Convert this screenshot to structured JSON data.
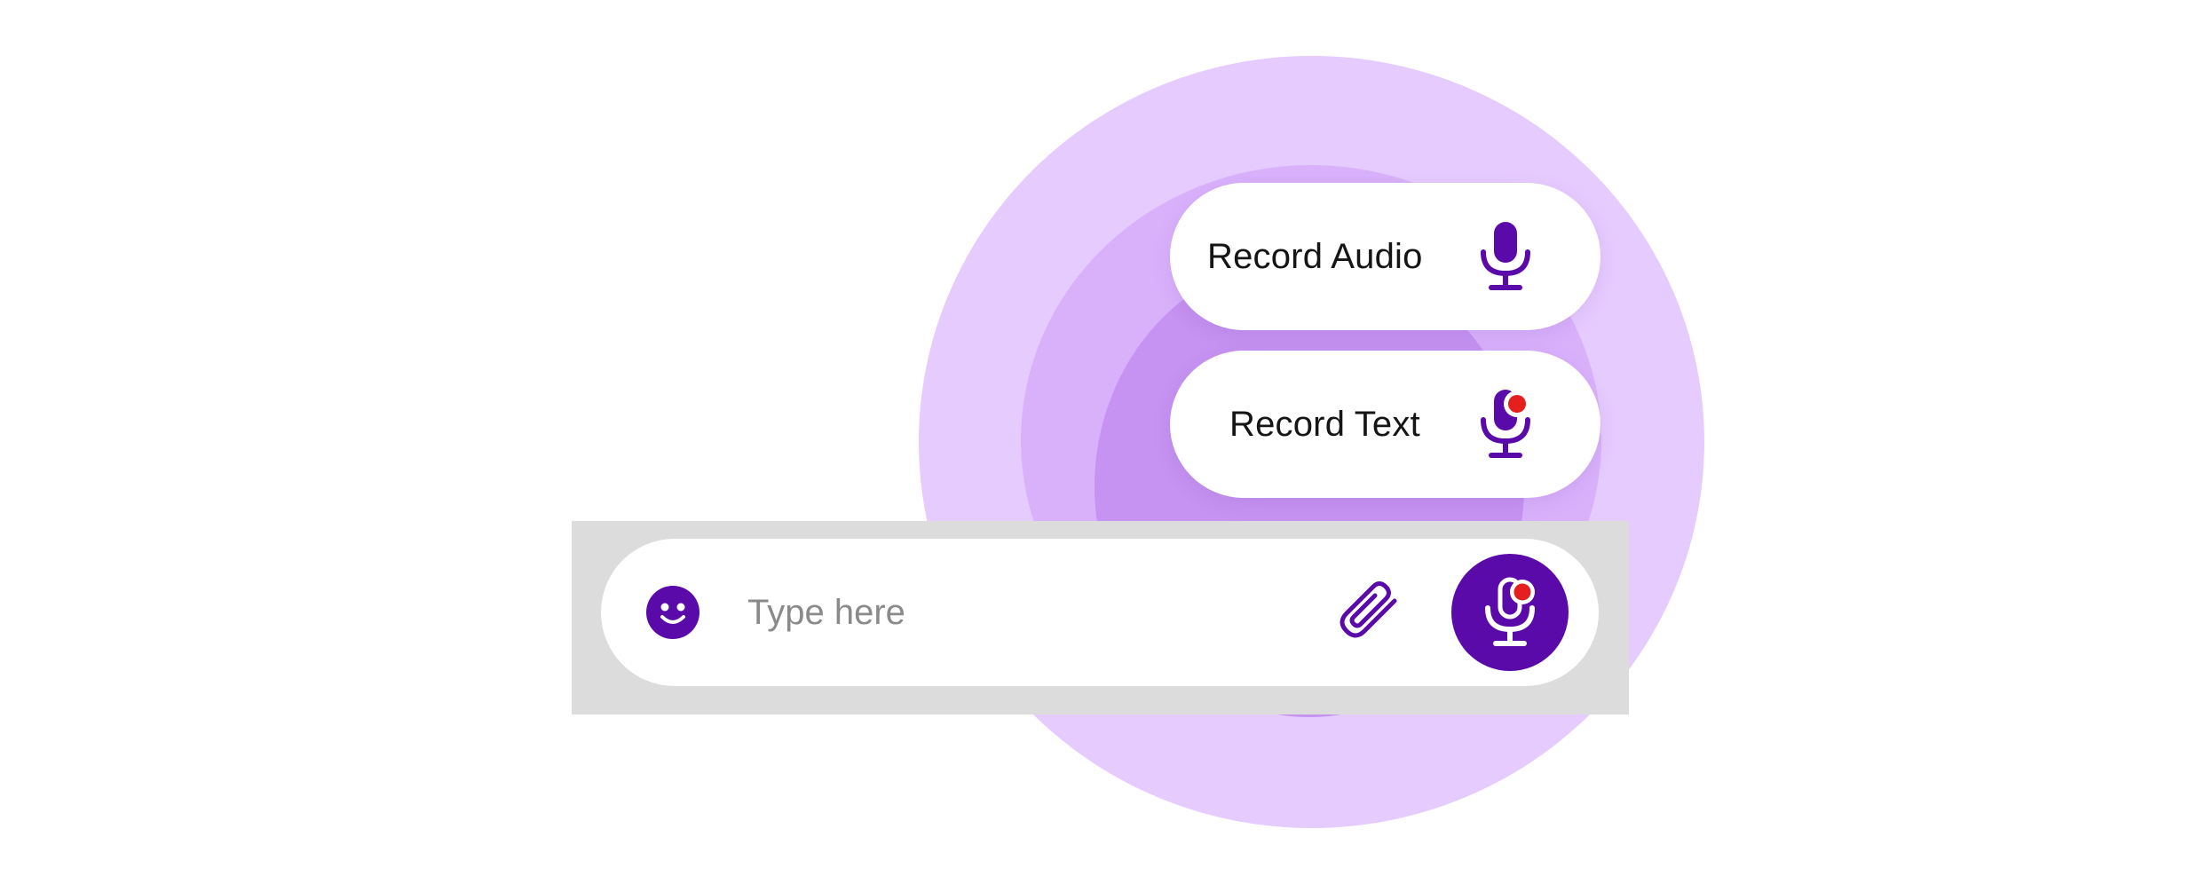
{
  "colors": {
    "accent": "#5a0aa8",
    "record_dot": "#e51e1e",
    "ring_outer": "#e6cbff",
    "ring_mid": "#d9b1fb",
    "ring_inner": "#c693f2",
    "composer_backdrop": "#dcdcdc"
  },
  "menu": {
    "record_audio": {
      "label": "Record Audio",
      "icon": "microphone-icon"
    },
    "record_text": {
      "label": "Record Text",
      "icon": "microphone-record-icon"
    }
  },
  "composer": {
    "emoji_icon": "smiley-icon",
    "input": {
      "placeholder": "Type here",
      "value": ""
    },
    "attach_icon": "paperclip-icon",
    "mic_icon": "microphone-record-icon"
  }
}
